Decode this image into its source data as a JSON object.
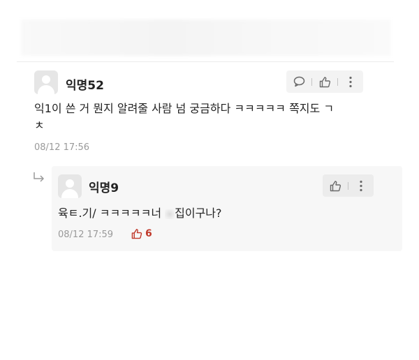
{
  "comment": {
    "nickname": "익명52",
    "text_line1": "익1이 쓴 거 뭔지 알려줄 사람 넘 궁금하다 ㅋㅋㅋㅋㅋ 쪽지도 ㄱ",
    "text_line2": "ㅊ",
    "time": "08/12 17:56",
    "actions": {
      "reply_icon": "chat-bubble-icon",
      "like_icon": "thumbs-up-icon",
      "more_icon": "more-vertical-icon"
    }
  },
  "reply": {
    "nickname": "익명9",
    "text_part1": "육ㅌ.기/ ㅋㅋㅋㅋㅋ너 ",
    "text_part2": "집이구나?",
    "time": "08/12 17:59",
    "like_count": "6",
    "colors": {
      "like_accent": "#c0392b",
      "box_background": "#f7f7f7"
    }
  }
}
